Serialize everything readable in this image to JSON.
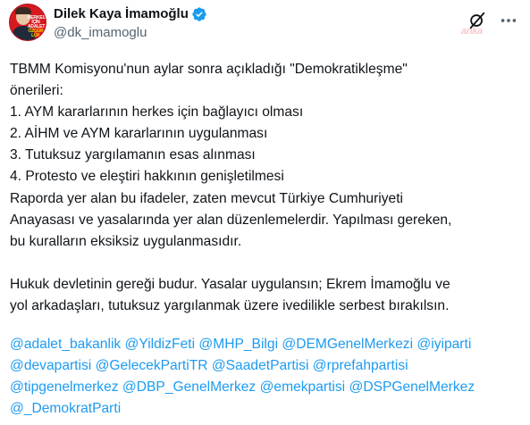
{
  "author": {
    "display_name": "Dilek Kaya İmamoğlu",
    "handle": "@dk_imamoglu",
    "avatar_slogan": [
      "HERKES İÇİN",
      "ADALET",
      "ÖZGÜR",
      "LÜK"
    ],
    "verified": true
  },
  "watermark": "anka",
  "post": {
    "lines": [
      "TBMM Komisyonu'nun aylar sonra açıkladığı \"Demokratikleşme\"",
      "önerileri:",
      "1. AYM kararlarının herkes için bağlayıcı olması",
      "2. AİHM ve AYM kararlarının uygulanması",
      "3. Tutuksuz yargılamanın esas alınması",
      "4. Protesto ve eleştiri hakkının genişletilmesi",
      "Raporda yer alan bu ifadeler, zaten mevcut Türkiye Cumhuriyeti",
      "Anayasası ve yasalarında yer alan düzenlemelerdir. Yapılması gereken,",
      "bu kuralların eksiksiz uygulanmasıdır."
    ],
    "lines2": [
      "Hukuk devletinin gereği budur. Yasalar uygulansın; Ekrem İmamoğlu ve",
      "yol arkadaşları, tutuksuz yargılanmak üzere ivedilikle serbest bırakılsın."
    ],
    "mention_lines": [
      [
        "@adalet_bakanlik",
        "@YildizFeti",
        "@MHP_Bilgi",
        "@DEMGenelMerkezi",
        "@iyiparti"
      ],
      [
        "@devapartisi",
        "@GelecekPartiTR",
        "@SaadetPartisi",
        "@rprefahpartisi"
      ],
      [
        "@tipgenelmerkez",
        "@DBP_GenelMerkez",
        "@emekpartisi",
        "@DSPGenelMerkez"
      ],
      [
        "@_DemokratParti"
      ]
    ]
  },
  "colors": {
    "link": "#1d9bf0",
    "text": "#0f1419",
    "secondary": "#536471",
    "verified": "#1d9bf0"
  },
  "icons": [
    "verified-badge-icon",
    "grok-icon",
    "more-options-icon"
  ]
}
